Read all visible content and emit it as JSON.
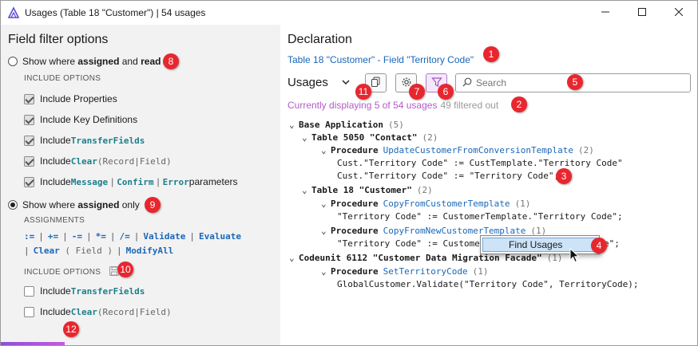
{
  "window": {
    "title": "Usages (Table 18 \"Customer\") | 54 usages"
  },
  "left_pane": {
    "title": "Field filter options",
    "option_read": {
      "prefix": "Show where ",
      "bold1": "assigned",
      "mid": " and ",
      "bold2": "read"
    },
    "include_options_caption": "Include options",
    "read_includes": [
      {
        "label": "Include Properties",
        "checked": true
      },
      {
        "label": "Include Key Definitions",
        "checked": true
      },
      {
        "prefix": "Include ",
        "kw": "TransferFields",
        "checked": true
      },
      {
        "prefix": "Include ",
        "kw": "Clear",
        "open": " ( ",
        "arg1": "Record",
        "bar": " | ",
        "arg2": "Field",
        "close": " )",
        "checked": true
      },
      {
        "prefix": "Include ",
        "kw1": "Message",
        "kw2": "Confirm",
        "kw3": "Error",
        "suffix": " parameters",
        "checked": true
      }
    ],
    "option_assigned": {
      "prefix": "Show where ",
      "bold": "assigned",
      "suffix": " only"
    },
    "assignments_caption": "Assignments",
    "assignment_ops": [
      ":=",
      "+=",
      "-=",
      "*=",
      "/=",
      "Validate",
      "Evaluate"
    ],
    "assignment_ops2": {
      "clear": "Clear",
      "open": " ( ",
      "field": "Field",
      "close": " )",
      "modify": "ModifyAll"
    },
    "include_options2_caption": "Include options",
    "assigned_includes": [
      {
        "prefix": "Include ",
        "kw": "TransferFields",
        "checked": false
      },
      {
        "prefix": "Include ",
        "kw": "Clear",
        "open": " ( ",
        "arg1": "Record",
        "bar": " | ",
        "arg2": "Field",
        "close": " )",
        "checked": false
      }
    ]
  },
  "right_pane": {
    "title": "Declaration",
    "declaration_link": "Table 18 \"Customer\"  -  Field \"Territory Code\"",
    "usages_label": "Usages",
    "search_placeholder": "Search",
    "status_count": "Currently displaying 5 of 54 usages",
    "status_filtered": "49 filtered out",
    "tree": {
      "root": {
        "label": "Base Application",
        "count": "(5)"
      },
      "t5050": {
        "label": "Table 5050 \"Contact\"",
        "count": "(2)"
      },
      "p1": {
        "kw": "Procedure",
        "name": "UpdateCustomerFromConversionTemplate",
        "count": "(2)"
      },
      "p1_l1": "Cust.\"Territory Code\" := CustTemplate.\"Territory Code\"",
      "p1_l2": "Cust.\"Territory Code\" := \"Territory Code\";",
      "t18": {
        "label": "Table 18 \"Customer\"",
        "count": "(2)"
      },
      "p2": {
        "kw": "Procedure",
        "name": "CopyFromCustomerTemplate",
        "count": "(1)"
      },
      "p2_l1": "\"Territory Code\" := CustomerTemplate.\"Territory Code\";",
      "p3": {
        "kw": "Procedure",
        "name": "CopyFromNewCustomerTemplate",
        "count": "(1)"
      },
      "p3_l1": "\"Territory Code\" := Custome",
      "p3_l1_tail": "e\";",
      "c6112": {
        "label": "Codeunit 6112 \"Customer Data Migration Facade\"",
        "count": "(1)"
      },
      "p4": {
        "kw": "Procedure",
        "name": "SetTerritoryCode",
        "count": "(1)"
      },
      "p4_l1": "GlobalCustomer.Validate(\"Territory Code\", TerritoryCode);"
    },
    "context_menu": {
      "find_usages": "Find Usages"
    }
  },
  "badges": [
    "1",
    "2",
    "3",
    "4",
    "5",
    "6",
    "7",
    "8",
    "9",
    "10",
    "11",
    "12"
  ],
  "colors": {
    "accent_purple": "#b35ac8",
    "link_blue": "#1a67b8",
    "keyword_teal": "#1d7f8a",
    "badge_red": "#e8262e"
  },
  "icons": {
    "app": "app-logo-icon",
    "minimize": "minimize-icon",
    "maximize": "maximize-icon",
    "close": "close-icon",
    "copy": "copy-icon",
    "settings": "gear-icon",
    "filter": "filter-icon",
    "search": "search-icon",
    "save": "save-icon",
    "cursor": "mouse-pointer-icon"
  }
}
